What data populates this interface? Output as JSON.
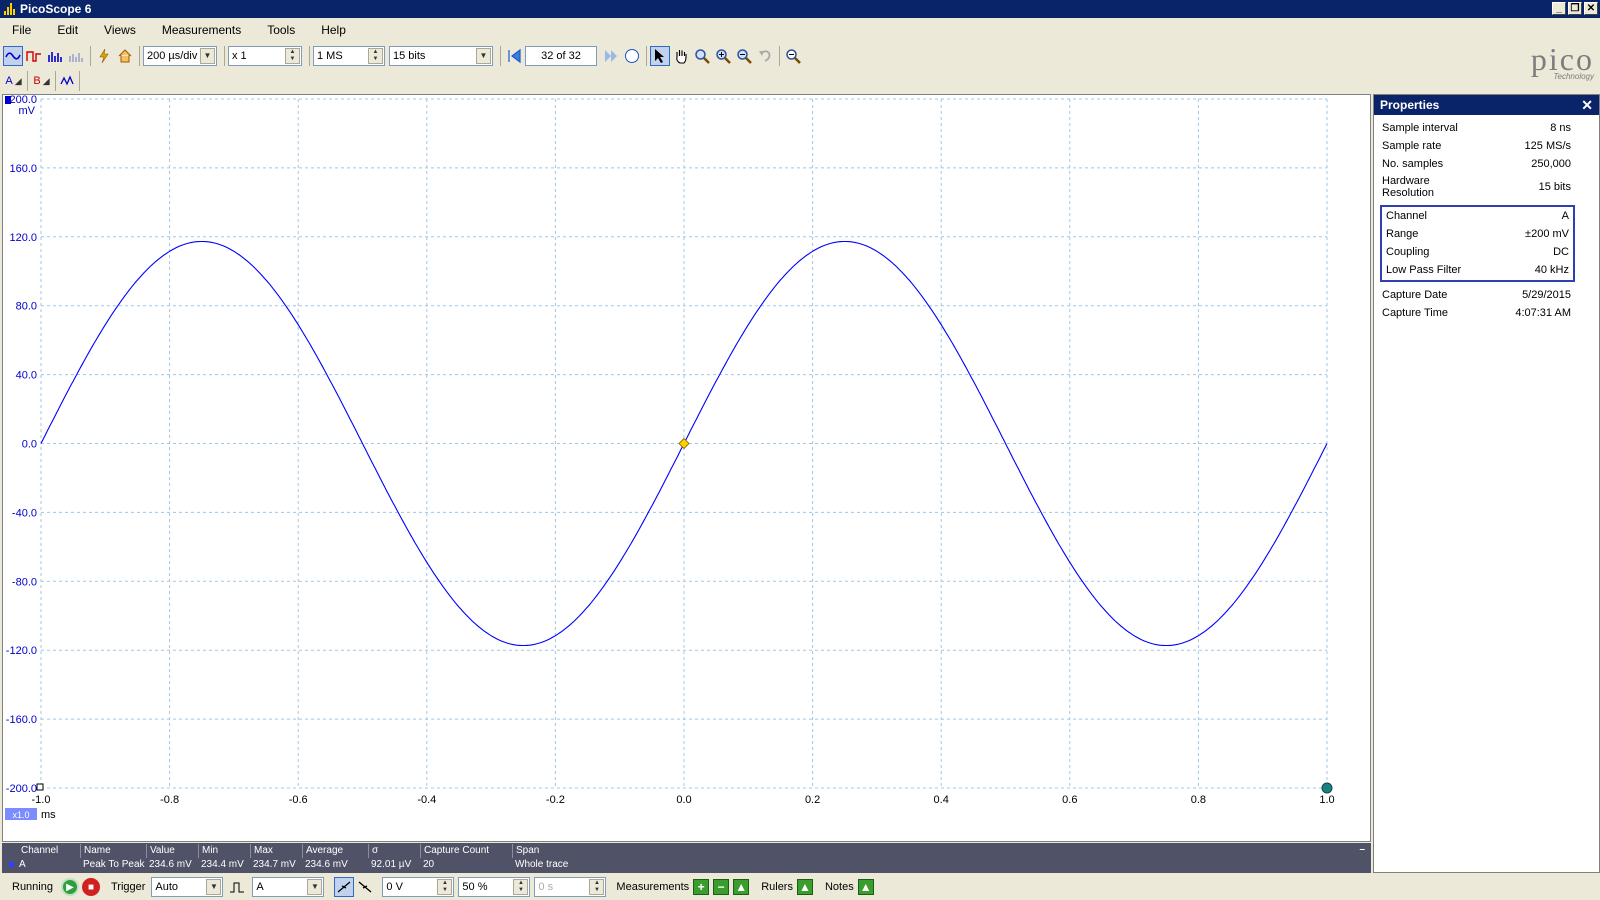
{
  "window": {
    "title": "PicoScope 6",
    "min": "_",
    "restore": "❐",
    "close": "✕"
  },
  "menu": [
    "File",
    "Edit",
    "Views",
    "Measurements",
    "Tools",
    "Help"
  ],
  "toolbar": {
    "timebase": "200 µs/div",
    "zoom": "x 1",
    "samples": "1 MS",
    "resolution": "15 bits",
    "buffer": "32 of 32"
  },
  "channels_bar": {
    "a": "A",
    "b": "B",
    "math": "M"
  },
  "logo": {
    "name": "pico",
    "sub": "Technology"
  },
  "chart_data": {
    "type": "line",
    "y_unit": "mV",
    "ylim": [
      -200,
      200
    ],
    "y_ticks": [
      "200.0",
      "160.0",
      "120.0",
      "80.0",
      "40.0",
      "0.0",
      "-40.0",
      "-80.0",
      "-120.0",
      "-160.0",
      "-200.0"
    ],
    "x_unit": "ms",
    "xlim": [
      -1.0,
      1.0
    ],
    "x_ticks": [
      "-1.0",
      "-0.8",
      "-0.6",
      "-0.4",
      "-0.2",
      "0.0",
      "0.2",
      "0.4",
      "0.6",
      "0.8",
      "1.0"
    ],
    "x_zoom": "x1.0",
    "grid": true,
    "series": [
      {
        "name": "A",
        "color": "#0000ff",
        "waveform": "sine",
        "amplitude_mV": 117.3,
        "period_ms": 1.0,
        "phase": "rising zero crossing at 0.0 ms",
        "x": [
          -1.0,
          -0.75,
          -0.5,
          -0.25,
          0.0,
          0.25,
          0.5,
          0.75,
          1.0
        ],
        "y": [
          0.0,
          117.3,
          0.0,
          -117.3,
          0.0,
          117.3,
          0.0,
          -117.3,
          0.0
        ]
      }
    ],
    "trigger_marker": {
      "x": 0.0,
      "y": 0.0,
      "color": "#ffd000"
    }
  },
  "measurements": {
    "headers": [
      "Channel",
      "Name",
      "Value",
      "Min",
      "Max",
      "Average",
      "σ",
      "Capture Count",
      "Span"
    ],
    "rows": [
      [
        "A",
        "Peak To Peak",
        "234.6 mV",
        "234.4 mV",
        "234.7 mV",
        "234.6 mV",
        "92.01 µV",
        "20",
        "Whole trace"
      ]
    ]
  },
  "properties": {
    "title": "Properties",
    "general": [
      {
        "label": "Sample interval",
        "value": "8 ns"
      },
      {
        "label": "Sample rate",
        "value": "125 MS/s"
      },
      {
        "label": "No. samples",
        "value": "250,000"
      },
      {
        "label": "Hardware\nResolution",
        "value": "15 bits"
      }
    ],
    "channel": [
      {
        "label": "Channel",
        "value": "A"
      },
      {
        "label": "Range",
        "value": "±200 mV"
      },
      {
        "label": "Coupling",
        "value": "DC"
      },
      {
        "label": "Low Pass Filter",
        "value": "40 kHz"
      }
    ],
    "capture": [
      {
        "label": "Capture Date",
        "value": "5/29/2015"
      },
      {
        "label": "Capture Time",
        "value": "4:07:31 AM"
      }
    ]
  },
  "statusbar": {
    "running": "Running",
    "trigger_label": "Trigger",
    "trigger_mode": "Auto",
    "trigger_channel": "A",
    "trigger_level": "0 V",
    "pre_trigger": "50 %",
    "delay": "0 s",
    "measurements": "Measurements",
    "rulers": "Rulers",
    "notes": "Notes"
  }
}
